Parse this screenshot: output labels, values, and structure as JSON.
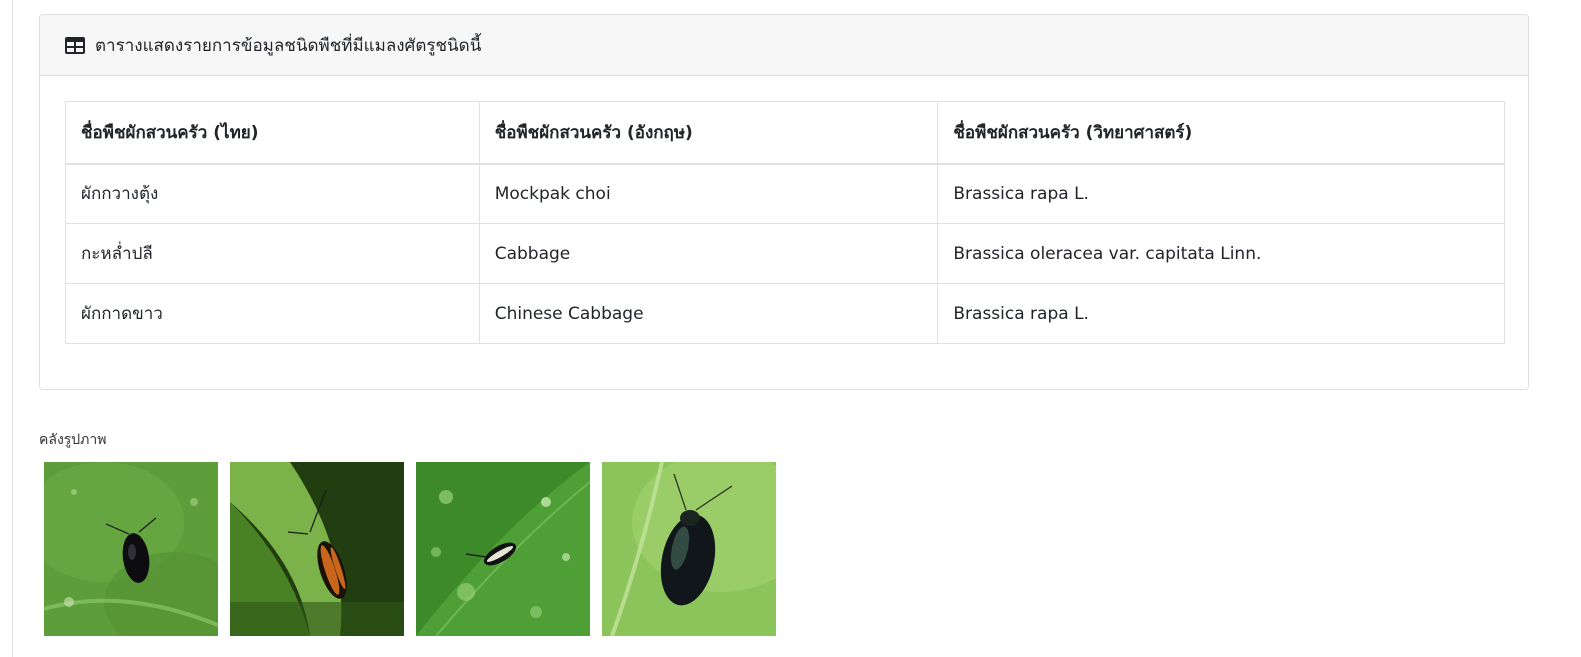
{
  "card": {
    "icon": "table-icon",
    "title": "ตารางแสดงรายการข้อมูลชนิดพืชที่มีแมลงศัตรูชนิดนี้"
  },
  "table": {
    "headers": [
      "ชื่อพืชผักสวนครัว (ไทย)",
      "ชื่อพืชผักสวนครัว (อังกฤษ)",
      "ชื่อพืชผักสวนครัว (วิทยาศาสตร์)"
    ],
    "rows": [
      [
        "ผักกวางตุ้ง",
        "Mockpak choi",
        "Brassica rapa L."
      ],
      [
        "กะหล่ำปลี",
        "Cabbage",
        "Brassica oleracea var. capitata Linn."
      ],
      [
        "ผักกาดขาว",
        "Chinese Cabbage",
        "Brassica rapa L."
      ]
    ]
  },
  "gallery": {
    "label": "คลังรูปภาพ",
    "images": [
      {
        "name": "black flea beetle on leaf"
      },
      {
        "name": "striped flea beetle on stem"
      },
      {
        "name": "striped flea beetle on wet leaf"
      },
      {
        "name": "metallic flea beetle on leaf"
      }
    ]
  },
  "colors": {
    "header_bg": "#f7f7f7",
    "border": "#dee2e6",
    "leaf_green": "#6fae3e"
  }
}
